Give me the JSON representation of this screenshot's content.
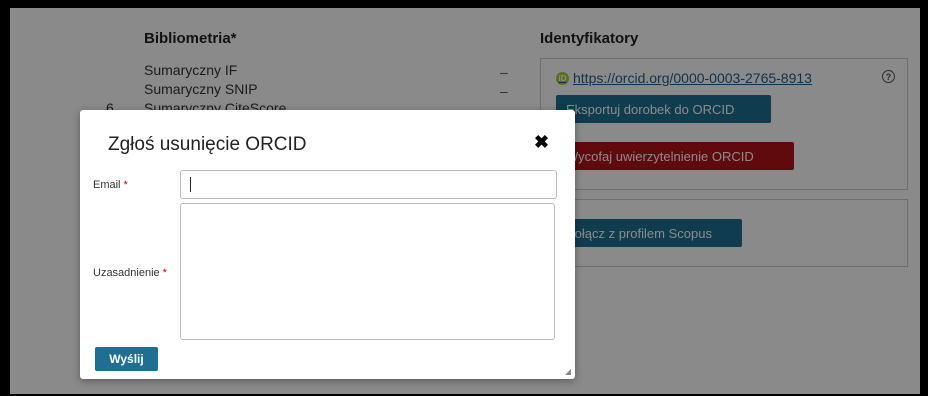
{
  "background": {
    "bibliometrics": {
      "title": "Bibliometria*",
      "rows": [
        {
          "label": "Sumaryczny IF",
          "value": "–"
        },
        {
          "label": "Sumaryczny SNIP",
          "value": "–"
        },
        {
          "label": "Sumaryczny CiteScore",
          "value": ""
        }
      ],
      "row_number": "6"
    },
    "identifiers": {
      "title": "Identyfikatory",
      "orcid_url": "https://orcid.org/0000-0003-2765-8913",
      "orcid_logo": "iD",
      "help_symbol": "?",
      "export_button": "Eksportuj dorobek do ORCID",
      "revoke_button": "Wycofaj uwierzytelnienie ORCID",
      "scopus_button": "Połącz z profilem Scopus"
    }
  },
  "modal": {
    "title": "Zgłoś usunięcie ORCID",
    "close_symbol": "✖",
    "email_label": "Email",
    "justification_label": "Uzasadnienie",
    "required_marker": "*",
    "email_value": "",
    "justification_value": "",
    "submit_label": "Wyślij"
  },
  "colors": {
    "primary_button": "#1e6f93",
    "danger_button": "#b3141b",
    "orcid_green": "#a6ce39"
  }
}
